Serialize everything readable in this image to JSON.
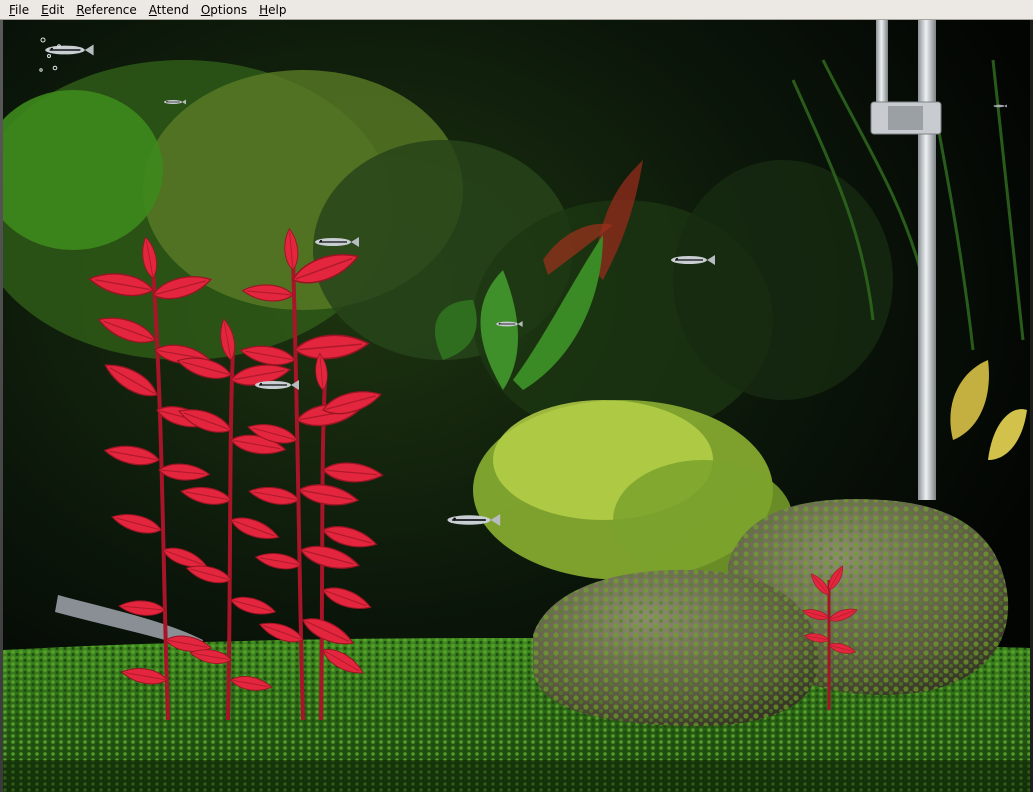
{
  "menubar": {
    "items": [
      {
        "label": "File",
        "accel": "F",
        "rest": "ile"
      },
      {
        "label": "Edit",
        "accel": "E",
        "rest": "dit"
      },
      {
        "label": "Reference",
        "accel": "R",
        "rest": "eference"
      },
      {
        "label": "Attend",
        "accel": "A",
        "rest": "ttend"
      },
      {
        "label": "Options",
        "accel": "O",
        "rest": "ptions"
      },
      {
        "label": "Help",
        "accel": "H",
        "rest": "elp"
      }
    ]
  },
  "scene": {
    "colors": {
      "background": "#050805",
      "gravel": "#2f6a18",
      "red_leaf": "#e0253c",
      "green_plant": "#4c7a1e",
      "yellow_plant": "#a8c83a",
      "rock": "#6f6a52",
      "moss": "#5d8f22",
      "heater_glass": "#c8ccd0"
    },
    "icons": [
      "fish-icon",
      "heater-tube-icon",
      "rock-icon",
      "plant-icon"
    ]
  }
}
